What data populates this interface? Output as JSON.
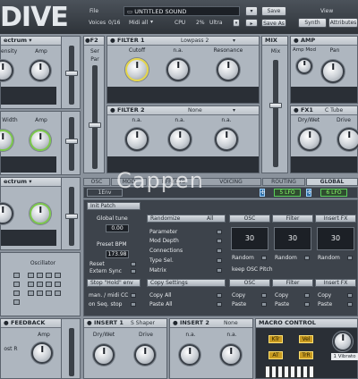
{
  "header": {
    "logo": "DIVE",
    "file_label": "File",
    "sound_name": "UNTITLED SOUND",
    "save_label": "Save",
    "save_as_label": "Save As",
    "voices_label": "Voices",
    "voices_value": "0/16",
    "midi_label": "Midi all",
    "cpu_label": "CPU",
    "cpu_value": "2%",
    "quality": "Ultra",
    "view_label": "View",
    "synth_tab": "Synth",
    "attributes_tab": "Attributes"
  },
  "osc_top": {
    "dropdown": "ectrum",
    "knob1_label": "ensity",
    "knob2_label": "Amp"
  },
  "osc_mid": {
    "knob1_label": "Width",
    "knob2_label": "Amp"
  },
  "osc_low": {
    "dropdown": "ectrum",
    "oscillator_label": "Oscillator"
  },
  "f2": {
    "title": "F2",
    "ser_label": "Ser",
    "par_label": "Par"
  },
  "filter1": {
    "title": "FILTER 1",
    "type": "Lowpass 2",
    "knob1_label": "Cutoff",
    "knob2_label": "n.a.",
    "knob3_label": "Resonance"
  },
  "filter2": {
    "title": "FILTER 2",
    "type": "None",
    "knob1_label": "n.a.",
    "knob2_label": "n.a.",
    "knob3_label": "n.a."
  },
  "mix": {
    "title": "MIX",
    "label": "Mix"
  },
  "amp": {
    "title": "AMP",
    "knob1_label": "Amp Mod",
    "knob2_label": "Pan"
  },
  "fx1": {
    "title": "FX1",
    "type": "C Tube",
    "knob1_label": "Dry/Wet",
    "knob2_label": "Drive"
  },
  "tabs": [
    "OSC",
    "MOD",
    "EFFECTS",
    "VOICING",
    "ROUTING",
    "GLOBAL"
  ],
  "mod_sources": [
    "1Env",
    "5 LFO",
    "6 LFO"
  ],
  "global": {
    "init_patch": "Init Patch",
    "global_tune_label": "Global tune",
    "global_tune_value": "0.00",
    "preset_bpm_label": "Preset BPM",
    "preset_bpm_value": "173.98",
    "reset_label": "Reset",
    "extern_sync_label": "Extern Sync",
    "stop_hold_label": "Stop \"Hold\" env",
    "man_midi_label": "man. / midi CC",
    "on_seq_label": "on Seq. stop",
    "randomize_label": "Randomize",
    "randomize_all": "All",
    "param_rows": [
      "Parameter",
      "Mod Depth",
      "Connections",
      "Type Sel.",
      "Matrix"
    ],
    "copy_settings_label": "Copy Settings",
    "copy_all": "Copy All",
    "paste_all": "Paste All",
    "cols": [
      "OSC",
      "Filter",
      "Insert FX"
    ],
    "col_values": [
      "30",
      "30",
      "30"
    ],
    "random": "Random",
    "keep_osc_pitch": "keep OSC Pitch",
    "copy": "Copy",
    "paste": "Paste"
  },
  "bottom": {
    "feedback_title": "FEEDBACK",
    "feedback_amp": "Amp",
    "feedback_left": "ost R",
    "insert1_title": "INSERT 1",
    "insert1_type": "S Shaper",
    "insert1_knob1": "Dry/Wet",
    "insert1_knob2": "Drive",
    "insert2_title": "INSERT 2",
    "insert2_type": "None",
    "insert2_knob1": "n.a.",
    "insert2_knob2": "n.a.",
    "macro_title": "MACRO CONTROL",
    "macro_buttons": [
      "KTr",
      "Vel",
      "AT",
      "TrR"
    ],
    "macro_readout": "1 Vibrato"
  },
  "watermark": "Cappen"
}
